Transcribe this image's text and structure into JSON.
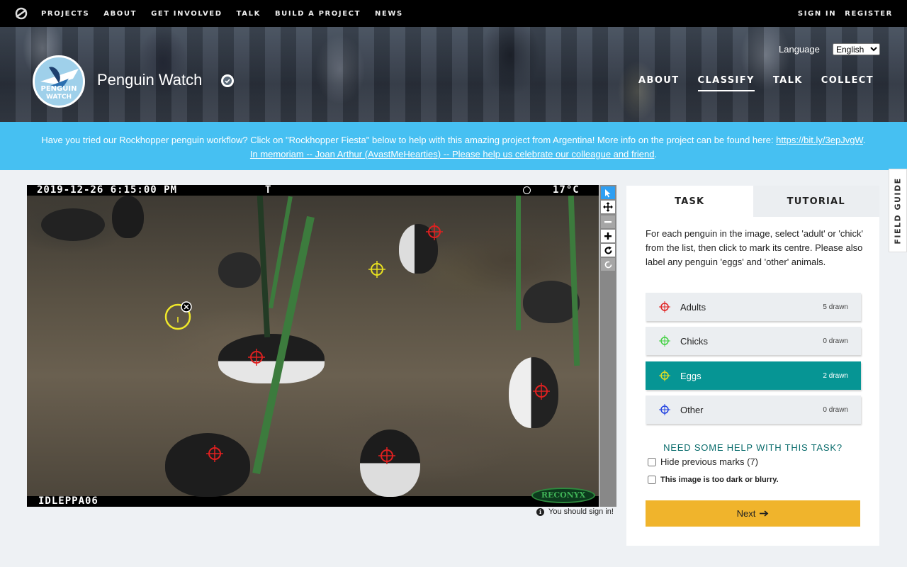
{
  "topnav": {
    "logo_icon": "zooniverse-logo-icon",
    "links": [
      "PROJECTS",
      "ABOUT",
      "GET INVOLVED",
      "TALK",
      "BUILD A PROJECT",
      "NEWS"
    ],
    "sign_in": "SIGN IN",
    "register": "REGISTER"
  },
  "project": {
    "avatar_text_1": "PENGUIN",
    "avatar_text_2": "WATCH",
    "title": "Penguin Watch",
    "verified_icon": "verified-check-icon",
    "language_label": "Language",
    "language_value": "English",
    "nav": [
      "ABOUT",
      "CLASSIFY",
      "TALK",
      "COLLECT"
    ],
    "active_nav": "CLASSIFY"
  },
  "announcement": {
    "line1": "Have you tried our Rockhopper penguin workflow? Click on \"Rockhopper Fiesta\" below to help with this amazing project from Argentina! More info on the project can be found here: ",
    "link1": "https://bit.ly/3epJvgW",
    "line1_end": ".",
    "link2": "In memoriam -- Joan Arthur (AvastMeHearties) -- Please help us celebrate our colleague and friend",
    "line2_end": "."
  },
  "field_guide": "FIELD GUIDE",
  "subject": {
    "date": "2019-12-26 6:15:00 PM",
    "temp_unit": "T",
    "temperature": "17°C",
    "camera_id": "IDLEPPA06",
    "brand": "RECONYX",
    "sign_in_notice": "You should sign in!"
  },
  "viewer_tools": [
    "pointer-icon",
    "move-icon",
    "zoom-out-icon",
    "zoom-in-icon",
    "rotate-icon",
    "reset-icon"
  ],
  "task": {
    "tabs": [
      "TASK",
      "TUTORIAL"
    ],
    "instructions": "For each penguin in the image, select 'adult' or 'chick' from the list, then click to mark its centre. Please also label any penguin 'eggs' and 'other' animals.",
    "tools": [
      {
        "label": "Adults",
        "count": "5 drawn",
        "color": "#e02020"
      },
      {
        "label": "Chicks",
        "count": "0 drawn",
        "color": "#40d040"
      },
      {
        "label": "Eggs",
        "count": "2 drawn",
        "color": "#e0e020"
      },
      {
        "label": "Other",
        "count": "0 drawn",
        "color": "#2040e0"
      }
    ],
    "active_tool": "Eggs",
    "help_text": "NEED SOME HELP WITH THIS TASK?",
    "hide_marks": "Hide previous marks (7)",
    "too_dark": "This image is too dark or blurry.",
    "next_label": "Next"
  }
}
